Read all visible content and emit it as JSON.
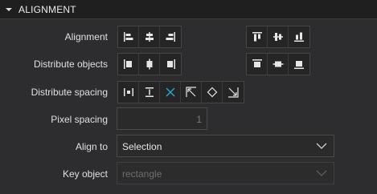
{
  "section": {
    "title": "ALIGNMENT",
    "collapse_icon": "triangle-down-icon"
  },
  "rows": {
    "alignment": {
      "label": "Alignment",
      "horizontal": [
        "align-left-icon",
        "align-center-horizontal-icon",
        "align-right-icon"
      ],
      "vertical": [
        "align-top-icon",
        "align-middle-vertical-icon",
        "align-bottom-icon"
      ]
    },
    "distribute_objects": {
      "label": "Distribute objects",
      "horizontal": [
        "distribute-left-icon",
        "distribute-center-horizontal-icon",
        "distribute-right-icon"
      ],
      "vertical": [
        "distribute-top-icon",
        "distribute-middle-vertical-icon",
        "distribute-bottom-icon"
      ]
    },
    "distribute_spacing": {
      "label": "Distribute spacing",
      "buttons": [
        "spacing-horizontal-icon",
        "spacing-vertical-icon",
        "spacing-none-icon",
        "spacing-top-left-icon",
        "spacing-diamond-icon",
        "spacing-bottom-right-icon"
      ]
    },
    "pixel_spacing": {
      "label": "Pixel spacing",
      "value": "1"
    },
    "align_to": {
      "label": "Align to",
      "value": "Selection"
    },
    "key_object": {
      "label": "Key object",
      "value": "rectangle"
    }
  },
  "colors": {
    "accent": "#2a9fd6",
    "icon": "#e6e6e6"
  }
}
